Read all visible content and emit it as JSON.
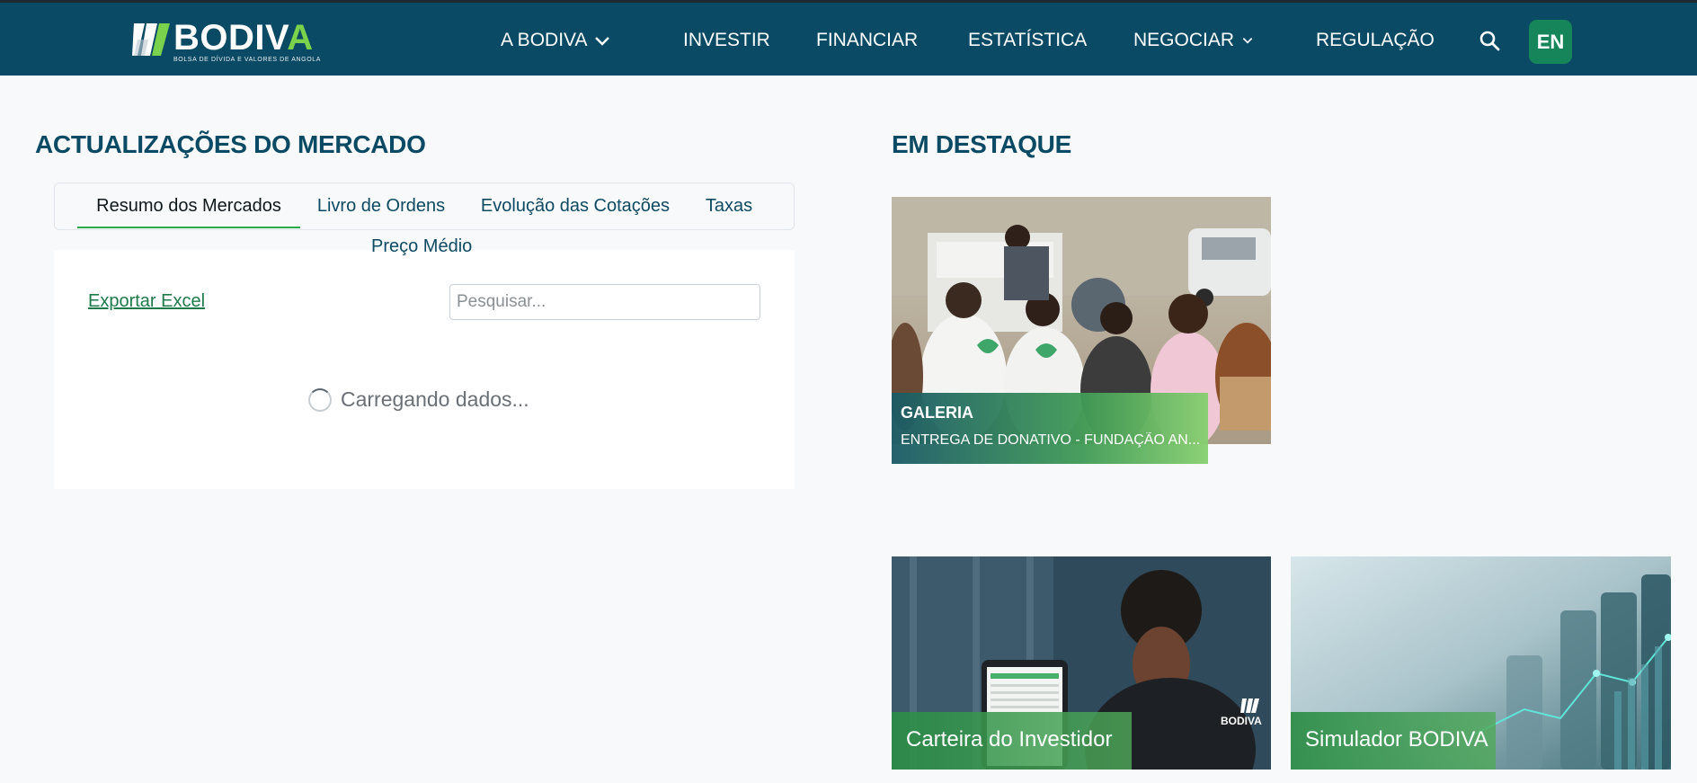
{
  "nav": {
    "logo_text_main": "BODIV",
    "logo_text_accent": "A",
    "logo_tagline": "BOLSA DE DÍVIDA E VALORES DE ANGOLA",
    "items": [
      {
        "label": "A BODIVA"
      },
      {
        "label": "INVESTIR"
      },
      {
        "label": "FINANCIAR"
      },
      {
        "label": "ESTATÍSTICA"
      },
      {
        "label": "NEGOCIAR"
      },
      {
        "label": "REGULAÇÃO"
      }
    ],
    "search_icon": "search-icon",
    "lang_button": "EN"
  },
  "market": {
    "title": "ACTUALIZAÇÕES DO MERCADO",
    "tabs": [
      {
        "label": "Resumo dos Mercados",
        "active": true
      },
      {
        "label": "Livro de Ordens"
      },
      {
        "label": "Evolução das Cotações"
      },
      {
        "label": "Taxas"
      }
    ],
    "subtab": "Preço Médio",
    "export_label": "Exportar Excel",
    "search_placeholder": "Pesquisar...",
    "loading_text": "Carregando dados..."
  },
  "featured": {
    "title": "EM DESTAQUE",
    "gallery": {
      "label": "GALERIA",
      "caption": "ENTREGA DE DONATIVO - FUNDAÇÃO AN..."
    },
    "cards": [
      {
        "label": "Carteira do Investidor",
        "watermark": "BODIVA"
      },
      {
        "label": "Simulador BODIVA"
      }
    ]
  },
  "colors": {
    "nav_bg": "#0a4a64",
    "accent_green": "#17855a",
    "title_blue": "#0b4a64",
    "active_tab_underline": "#2aa84a"
  }
}
